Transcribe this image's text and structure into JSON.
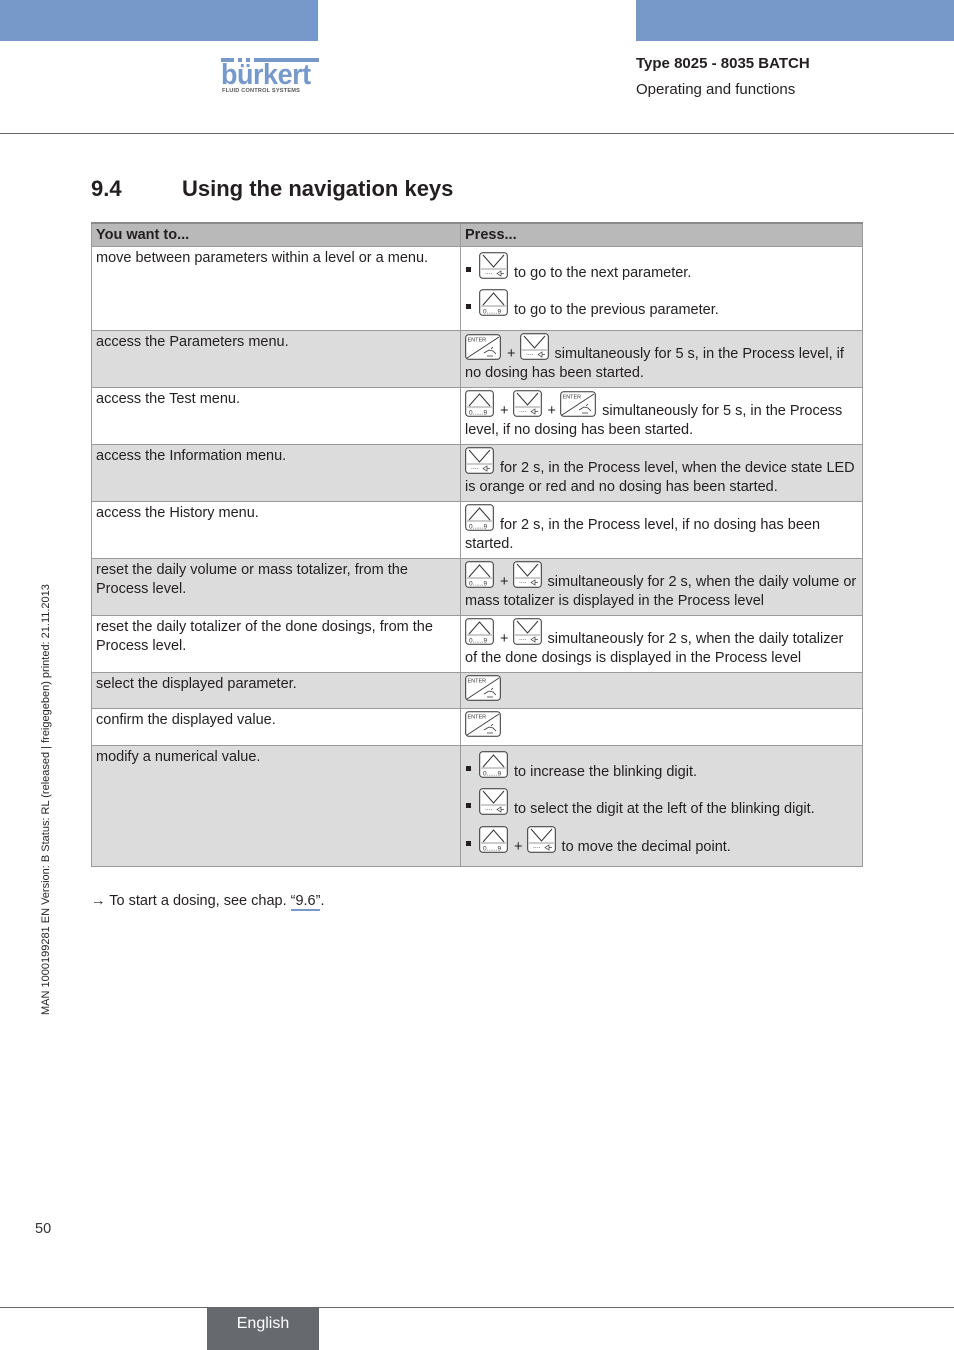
{
  "header": {
    "brand": "bürkert",
    "brand_tagline": "FLUID CONTROL SYSTEMS",
    "doc_type": "Type 8025 - 8035 BATCH",
    "doc_subtitle": "Operating and functions",
    "accent_color": "#7799c9"
  },
  "section": {
    "number": "9.4",
    "title": "Using the navigation keys"
  },
  "table": {
    "headers": [
      "You want to...",
      "Press..."
    ],
    "keys": {
      "down": {
        "icon": "arrow-down-key-icon",
        "sublabel": "····⊲"
      },
      "up": {
        "icon": "arrow-up-key-icon",
        "sublabel": "0......9"
      },
      "enter": {
        "icon": "enter-key-icon",
        "label": "ENTER"
      }
    },
    "plus": "+",
    "rows": [
      {
        "action": "move between parameters within a level or a menu.",
        "bullets": [
          {
            "keys": [
              "down"
            ],
            "text": "to go to the next parameter."
          },
          {
            "keys": [
              "up"
            ],
            "text": "to go to the previous parameter."
          }
        ]
      },
      {
        "action": "access the Parameters menu.",
        "keys": [
          "enter",
          "down"
        ],
        "text": "simultaneously for 5 s, in the Process level, if no dosing has been started."
      },
      {
        "action": "access the Test menu.",
        "keys": [
          "up",
          "down",
          "enter"
        ],
        "text": "simultaneously for 5 s, in the Process level, if no dosing has been started."
      },
      {
        "action": "access the Information menu.",
        "keys": [
          "down"
        ],
        "text": "for 2 s, in the Process level, when the device state LED is orange or red and no dosing has been started."
      },
      {
        "action": "access the History menu.",
        "keys": [
          "up"
        ],
        "text": "for 2 s, in the Process level, if no dosing has been started."
      },
      {
        "action": "reset the daily volume or mass totalizer, from the Process level.",
        "keys": [
          "up",
          "down"
        ],
        "text": "simultaneously for 2 s, when the daily volume or mass totalizer is displayed in the Process level"
      },
      {
        "action": "reset the daily totalizer of the done dosings, from the Process level.",
        "keys": [
          "up",
          "down"
        ],
        "text": "simultaneously for 2 s, when the daily totalizer of the done dosings is displayed in the Process level"
      },
      {
        "action": "select the displayed parameter.",
        "keys": [
          "enter"
        ],
        "text": ""
      },
      {
        "action": "confirm the displayed value.",
        "keys": [
          "enter"
        ],
        "text": ""
      },
      {
        "action": "modify a numerical value.",
        "bullets": [
          {
            "keys": [
              "up"
            ],
            "text": "to increase the blinking digit."
          },
          {
            "keys": [
              "down"
            ],
            "text": "to select the digit at the left of the blinking digit."
          },
          {
            "keys": [
              "up",
              "down"
            ],
            "text": "to move the decimal point."
          }
        ]
      }
    ]
  },
  "note": {
    "arrow": "→",
    "text": "To start a dosing, see chap.",
    "link": "“9.6”",
    "suffix": "."
  },
  "side_text": "MAN  1000199281  EN  Version: B  Status: RL (released | freigegeben)  printed: 21.11.2013",
  "footer": {
    "page_number": "50",
    "language": "English"
  }
}
